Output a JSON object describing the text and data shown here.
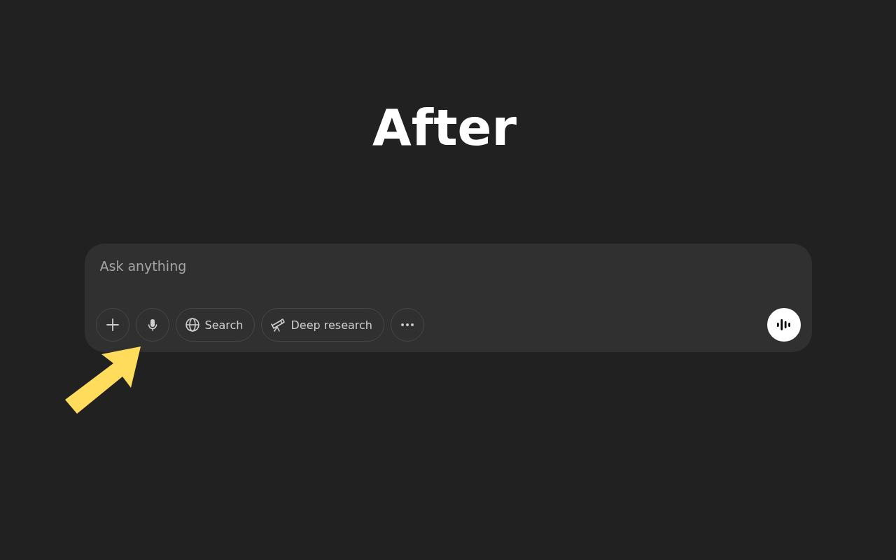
{
  "heading": "After",
  "composer": {
    "placeholder": "Ask anything",
    "tools": [
      {
        "kind": "add"
      },
      {
        "kind": "voice"
      },
      {
        "kind": "search",
        "label": "Search"
      },
      {
        "kind": "research",
        "label": "Deep research"
      },
      {
        "kind": "more"
      }
    ],
    "send": {
      "kind": "voice-mode"
    }
  },
  "annotation": {
    "kind": "arrow"
  }
}
